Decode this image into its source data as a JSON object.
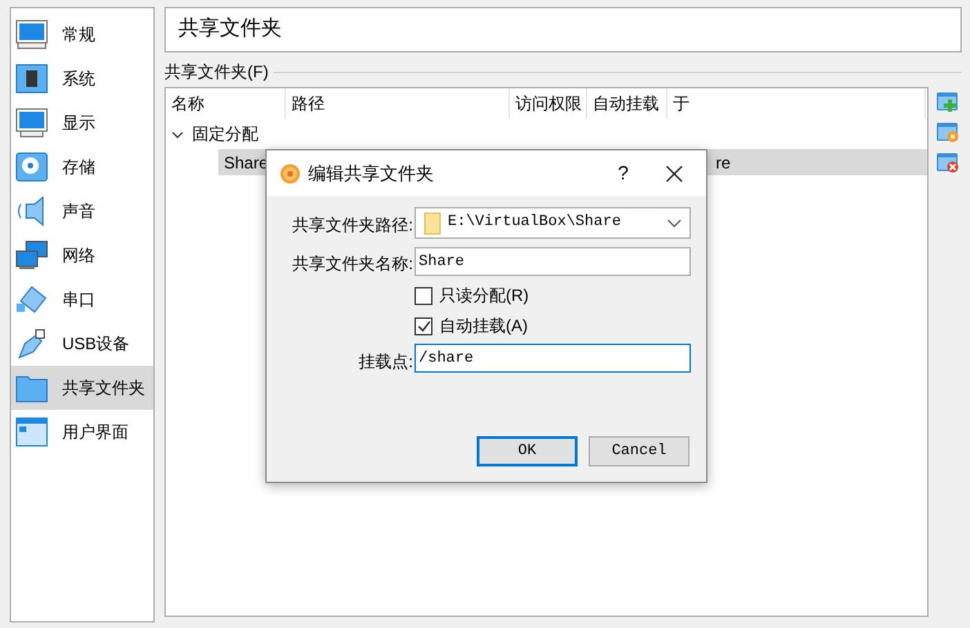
{
  "sidebar": {
    "items": [
      {
        "label": "常规",
        "selected": false
      },
      {
        "label": "系统",
        "selected": false
      },
      {
        "label": "显示",
        "selected": false
      },
      {
        "label": "存储",
        "selected": false
      },
      {
        "label": "声音",
        "selected": false
      },
      {
        "label": "网络",
        "selected": false
      },
      {
        "label": "串口",
        "selected": false
      },
      {
        "label": "USB设备",
        "selected": false
      },
      {
        "label": "共享文件夹",
        "selected": true
      },
      {
        "label": "用户界面",
        "selected": false
      }
    ]
  },
  "page_title": "共享文件夹",
  "group_label": "共享文件夹(F)",
  "table": {
    "columns": [
      "名称",
      "路径",
      "访问权限",
      "自动挂载",
      "于"
    ],
    "groups": [
      {
        "label": "固定分配",
        "expanded": true,
        "rows": [
          {
            "name": "Share",
            "column_5": "re",
            "selected": true
          }
        ]
      }
    ]
  },
  "dialog": {
    "title": "编辑共享文件夹",
    "help": "?",
    "path_label": "共享文件夹路径:",
    "path_value": "E:\\VirtualBox\\Share",
    "name_label": "共享文件夹名称:",
    "name_value": "Share",
    "checkboxes": [
      {
        "label": "只读分配(R)",
        "checked": false
      },
      {
        "label": "自动挂载(A)",
        "checked": true
      }
    ],
    "mount_label": "挂载点:",
    "mount_value": "/share",
    "buttons": [
      "OK",
      "Cancel"
    ]
  }
}
